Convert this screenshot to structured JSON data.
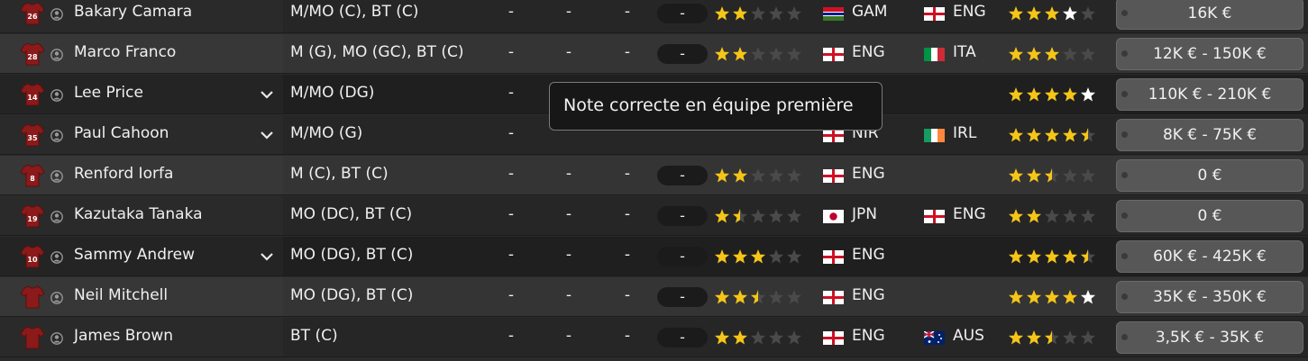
{
  "colors": {
    "star_on": "#f5c518",
    "star_off": "#4a4a4a",
    "star_white": "#ffffff",
    "shirt": "#8b1a1a"
  },
  "tooltip": {
    "text": "Note correcte en équipe première"
  },
  "players": [
    {
      "number": "26",
      "name": "Bakary Camara",
      "position": "M/MO (C), BT (C)",
      "stat1": "-",
      "stat2": "-",
      "stat3": "-",
      "pill": "-",
      "current_ability": 2,
      "nationality": "GAM",
      "nationality_flag": "gambia-flag-icon",
      "second_nationality": "ENG",
      "second_flag": "england-flag-icon",
      "potential_ability": 3,
      "potential_white": 1,
      "value": "16K €",
      "expanded": false
    },
    {
      "number": "28",
      "name": "Marco Franco",
      "position": "M (G), MO (GC), BT (C)",
      "stat1": "-",
      "stat2": "-",
      "stat3": "-",
      "pill": "-",
      "current_ability": 2,
      "nationality": "ENG",
      "nationality_flag": "england-flag-icon",
      "second_nationality": "ITA",
      "second_flag": "italy-flag-icon",
      "potential_ability": 3,
      "potential_white": 0,
      "value": "12K € - 150K €",
      "expanded": false
    },
    {
      "number": "14",
      "name": "Lee Price",
      "position": "M/MO (DG)",
      "stat1": "-",
      "stat2": "",
      "stat3": "",
      "pill": "",
      "current_ability": 0,
      "nationality": "",
      "nationality_flag": "",
      "second_nationality": "",
      "second_flag": "",
      "potential_ability": 4,
      "potential_white": 1,
      "value": "110K € - 210K €",
      "expanded": true
    },
    {
      "number": "35",
      "name": "Paul Cahoon",
      "position": "M/MO (G)",
      "stat1": "-",
      "stat2": "",
      "stat3": "",
      "pill": "",
      "current_ability": 0,
      "nationality": "NIR",
      "nationality_flag": "northern-ireland-flag-icon",
      "second_nationality": "IRL",
      "second_flag": "ireland-flag-icon",
      "potential_ability": 4.5,
      "potential_white": 0,
      "value": "8K € - 75K €",
      "expanded": true
    },
    {
      "number": "8",
      "name": "Renford Iorfa",
      "position": "M (C), BT (C)",
      "stat1": "-",
      "stat2": "-",
      "stat3": "-",
      "pill": "-",
      "current_ability": 2,
      "nationality": "ENG",
      "nationality_flag": "england-flag-icon",
      "second_nationality": "",
      "second_flag": "",
      "potential_ability": 2.5,
      "potential_white": 0,
      "value": "0 €",
      "expanded": false
    },
    {
      "number": "19",
      "name": "Kazutaka Tanaka",
      "position": "MO (DC), BT (C)",
      "stat1": "-",
      "stat2": "-",
      "stat3": "-",
      "pill": "-",
      "current_ability": 1.5,
      "nationality": "JPN",
      "nationality_flag": "japan-flag-icon",
      "second_nationality": "ENG",
      "second_flag": "england-flag-icon",
      "potential_ability": 2,
      "potential_white": 0,
      "value": "0 €",
      "expanded": false
    },
    {
      "number": "10",
      "name": "Sammy Andrew",
      "position": "MO (DG), BT (C)",
      "stat1": "-",
      "stat2": "-",
      "stat3": "-",
      "pill": "-",
      "current_ability": 3,
      "nationality": "ENG",
      "nationality_flag": "england-flag-icon",
      "second_nationality": "",
      "second_flag": "",
      "potential_ability": 4.5,
      "potential_white": 0,
      "value": "60K € - 425K €",
      "expanded": true
    },
    {
      "number": "",
      "name": "Neil Mitchell",
      "position": "MO (DG), BT (C)",
      "stat1": "-",
      "stat2": "-",
      "stat3": "-",
      "pill": "-",
      "current_ability": 2.5,
      "nationality": "ENG",
      "nationality_flag": "england-flag-icon",
      "second_nationality": "",
      "second_flag": "",
      "potential_ability": 4,
      "potential_white": 1,
      "value": "35K € - 350K €",
      "expanded": false
    },
    {
      "number": "",
      "name": "James Brown",
      "position": "BT (C)",
      "stat1": "-",
      "stat2": "-",
      "stat3": "-",
      "pill": "-",
      "current_ability": 2,
      "nationality": "ENG",
      "nationality_flag": "england-flag-icon",
      "second_nationality": "AUS",
      "second_flag": "australia-flag-icon",
      "potential_ability": 2.5,
      "potential_white": 0,
      "value": "3,5K € - 35K €",
      "expanded": false
    }
  ]
}
